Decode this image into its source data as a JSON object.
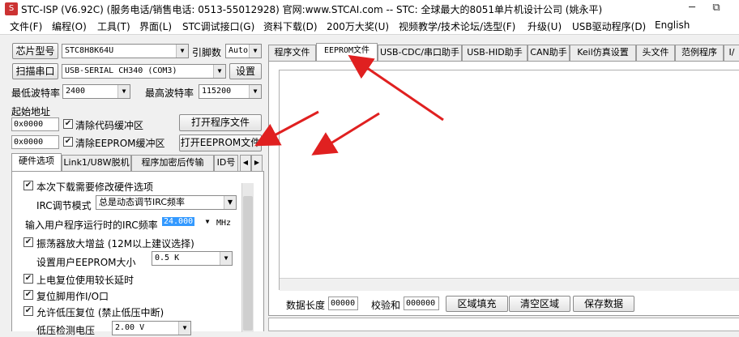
{
  "window": {
    "title": "STC-ISP (V6.92C) (服务电话/销售电话: 0513-55012928) 官网:www.STCAI.com  -- STC: 全球最大的8051单片机设计公司 (姚永平)",
    "minimize": "─",
    "restore": "⧉"
  },
  "menu": [
    "文件(F)",
    "编程(O)",
    "工具(T)",
    "界面(L)",
    "STC调试接口(G)",
    "资料下载(D)",
    "200万大奖(U)",
    "视频教学/技术论坛/选型(F)",
    "升级(U)",
    "USB驱动程序(D)",
    "English"
  ],
  "left": {
    "chip_button": "芯片型号",
    "chip_value": "STC8H8K64U",
    "pin_label": "引脚数",
    "pin_value": "Auto",
    "scan_button": "扫描串口",
    "port_value": "USB-SERIAL CH340 (COM3)",
    "settings_button": "设置",
    "min_baud_label": "最低波特率",
    "min_baud_value": "2400",
    "max_baud_label": "最高波特率",
    "max_baud_value": "115200",
    "start_addr_label": "起始地址",
    "addr1": "0x0000",
    "clear_code": "清除代码缓冲区",
    "open_program": "打开程序文件",
    "addr2": "0x0000",
    "clear_eeprom": "清除EEPROM缓冲区",
    "open_eeprom": "打开EEPROM文件",
    "tabs": [
      "硬件选项",
      "Link1/U8W脱机",
      "程序加密后传输",
      "ID号"
    ],
    "options": {
      "opt1": "本次下载需要修改硬件选项",
      "irc_mode_label": "IRC调节模式",
      "irc_mode_value": "总是动态调节IRC频率",
      "irc_freq_label": "输入用户程序运行时的IRC频率",
      "irc_freq_value": "24.000",
      "irc_freq_unit": "MHz",
      "opt2": "振荡器放大增益 (12M以上建议选择)",
      "eeprom_size_label": "设置用户EEPROM大小",
      "eeprom_size_value": "0.5 K",
      "opt3": "上电复位使用较长延时",
      "opt4": "复位脚用作I/O口",
      "opt5": "允许低压复位 (禁止低压中断)",
      "lv_label": "低压检测电压",
      "lv_value": "2.00 V"
    }
  },
  "right": {
    "tabs": [
      "程序文件",
      "EEPROM文件",
      "USB-CDC/串口助手",
      "USB-HID助手",
      "CAN助手",
      "Keil仿真设置",
      "头文件",
      "范例程序",
      "I/"
    ],
    "data_len_label": "数据长度",
    "data_len_value": "00000",
    "checksum_label": "校验和",
    "checksum_value": "000000",
    "fill_button": "区域填充",
    "clear_button": "清空区域",
    "save_button": "保存数据"
  },
  "colors": {
    "arrow": "#e02020",
    "freq_highlight": "#3399ff"
  }
}
